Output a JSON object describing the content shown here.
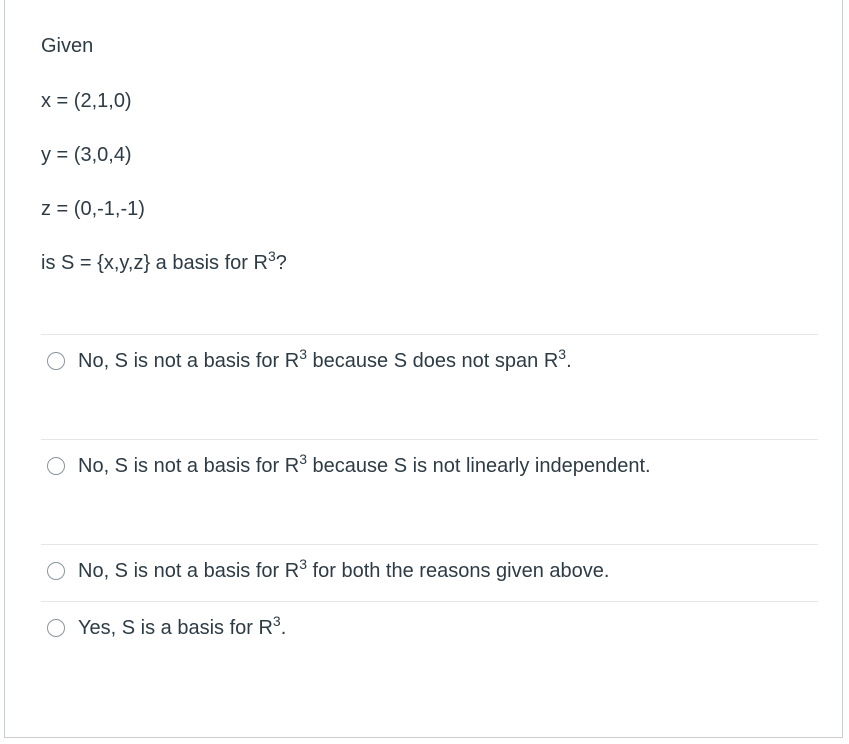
{
  "question": {
    "intro": "Given",
    "x_def": "x = (2,1,0)",
    "y_def": "y = (3,0,4)",
    "z_def": "z = (0,-1,-1)",
    "prompt_before": "is S = {x,y,z} a basis for R",
    "prompt_exp": "3",
    "prompt_after": "?"
  },
  "options": [
    {
      "before": "No, S is not a basis for R",
      "exp": "3",
      "after": " because S does not span R",
      "exp2": "3",
      "end": "."
    },
    {
      "before": "No, S is not a basis for R",
      "exp": "3",
      "after": " because S is not linearly independent."
    },
    {
      "before": "No, S is not a basis for R",
      "exp": "3",
      "after": " for both the reasons given above."
    },
    {
      "before": "Yes, S is a basis for R",
      "exp": "3",
      "after": "."
    }
  ],
  "colors": {
    "text": "#2d3b45",
    "border": "#c7cdd1",
    "divider": "#e4e6e8",
    "radio_border": "#8b969e"
  }
}
